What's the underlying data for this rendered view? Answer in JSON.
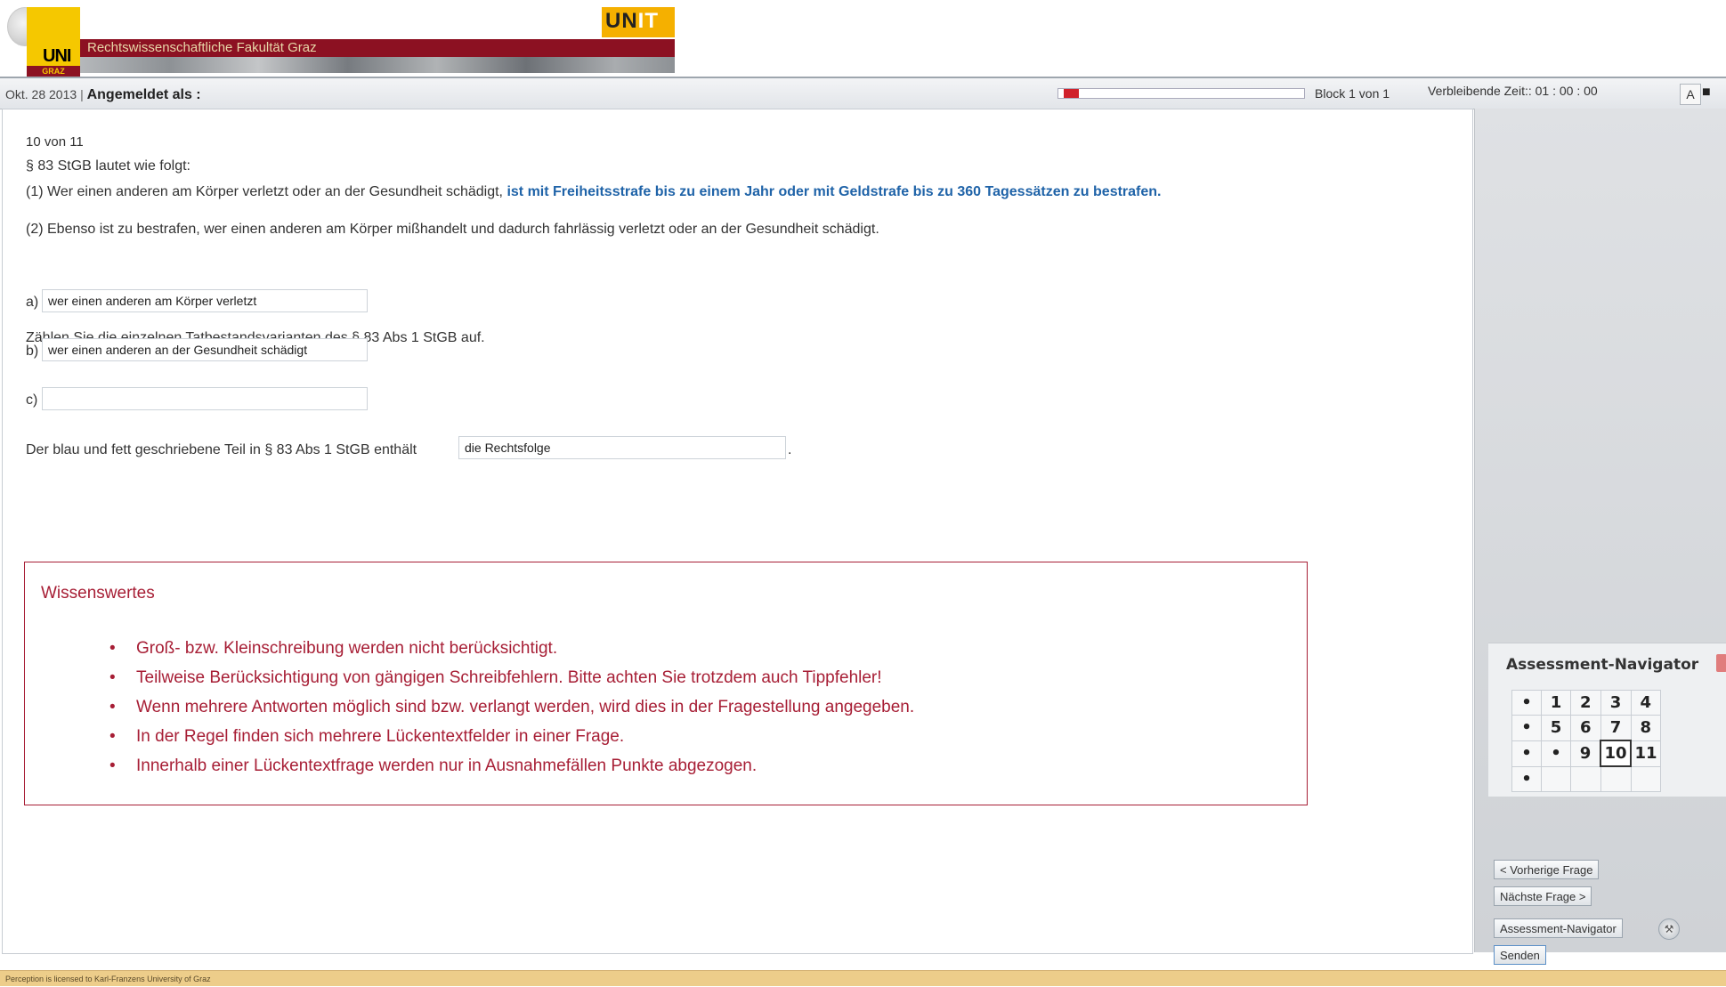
{
  "header": {
    "uni_text": "UNI",
    "uni_sub": "GRAZ",
    "faculty": "Rechtswissenschaftliche Fakultät Graz",
    "unit_logo_a": "UN",
    "unit_logo_b": "IT"
  },
  "status": {
    "date": "Okt. 28 2013",
    "separator": "|",
    "logged_in": "Angemeldet als :",
    "progress_fraction": 0.06,
    "block": "Block 1 von 1",
    "time_remaining": "Verbleibende Zeit:: 01 : 00 : 00",
    "font_button": "A"
  },
  "question": {
    "counter": "10 von 11",
    "intro": "§ 83 StGB lautet wie folgt:",
    "para1_plain": "(1) Wer einen anderen am Körper verletzt oder an der Gesundheit schädigt, ",
    "para1_highlight": "ist mit Freiheitsstrafe bis zu einem Jahr oder mit Geldstrafe bis zu 360 Tagessätzen zu bestrafen.",
    "para2": "(2) Ebenso ist zu bestrafen, wer einen anderen am Körper mißhandelt und dadurch fahrlässig verletzt oder an der Gesundheit schädigt.",
    "task": "Zählen Sie die einzelnen Tatbestandsvarianten des § 83 Abs 1 StGB auf.",
    "answers": [
      {
        "label": "a)",
        "value": "wer einen anderen am Körper verletzt"
      },
      {
        "label": "b)",
        "value": "wer einen anderen an der Gesundheit schädigt"
      },
      {
        "label": "c)",
        "value": ""
      }
    ],
    "last_prefix": "Der blau und fett geschriebene Teil in § 83 Abs 1 StGB enthält",
    "last_value": "die Rechtsfolge",
    "last_suffix": "."
  },
  "info": {
    "title": "Wissenswertes",
    "bullet": "•",
    "items": [
      "Groß- bzw. Kleinschreibung werden nicht berücksichtigt.",
      "Teilweise Berücksichtigung von gängigen Schreibfehlern. Bitte achten Sie trotzdem auch Tippfehler!",
      "Wenn mehrere Antworten möglich sind bzw. verlangt werden, wird dies in der Fragestellung angegeben.",
      "In der Regel finden sich mehrere Lückentextfelder in einer Frage.",
      "Innerhalb einer Lückentextfrage werden nur in Ausnahmefällen Punkte abgezogen."
    ]
  },
  "navigator": {
    "title": "Assessment-Navigator",
    "rows": [
      [
        "•",
        "1",
        "2",
        "3",
        "4"
      ],
      [
        "•",
        "5",
        "6",
        "7",
        "8"
      ],
      [
        "•",
        "•",
        "9",
        "10",
        "11"
      ],
      [
        "•",
        "",
        "",
        "",
        ""
      ]
    ],
    "current": "10"
  },
  "buttons": {
    "prev": "< Vorherige Frage",
    "next": "Nächste Frage >",
    "navigator": "Assessment-Navigator",
    "send": "Senden"
  },
  "footer": {
    "license": "Perception is licensed to Karl-Franzens University of Graz"
  },
  "colors": {
    "brand_red": "#8c1122",
    "brand_yellow": "#f5c800",
    "highlight_blue": "#1f63a8",
    "info_red": "#a71e35"
  }
}
